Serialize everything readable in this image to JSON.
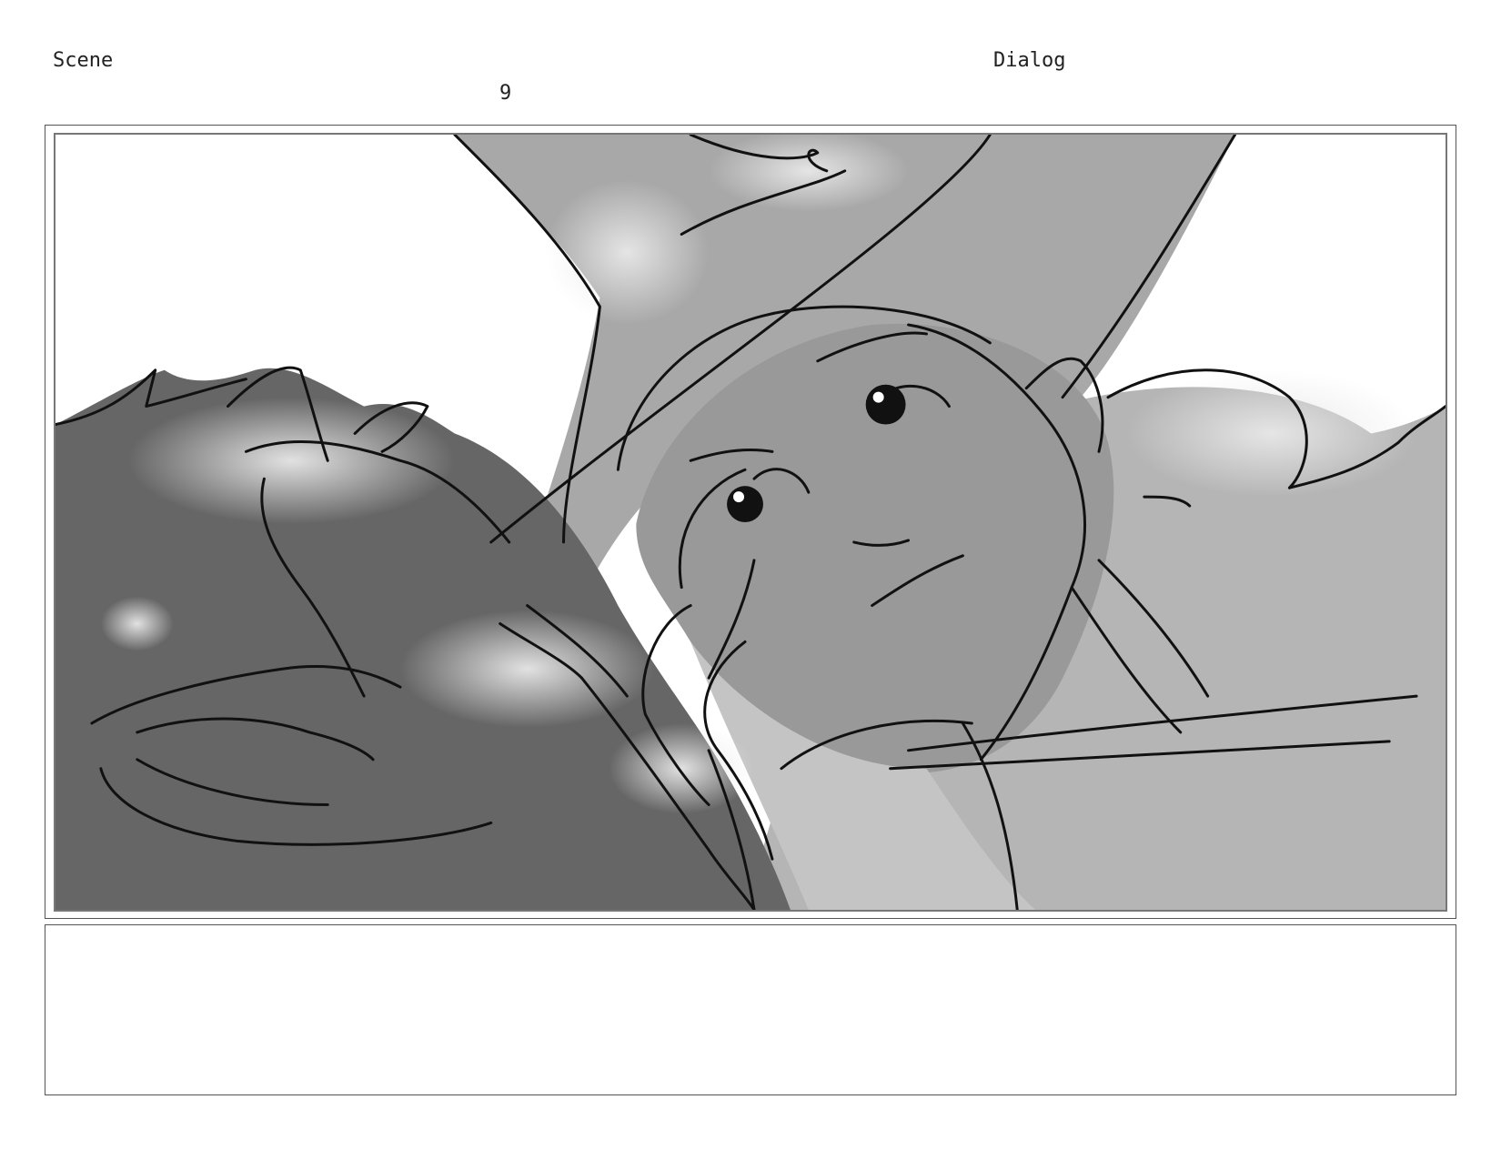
{
  "header": {
    "scene_label": "Scene",
    "scene_number": "9",
    "dialog_label": "Dialog"
  },
  "panel": {
    "content": "storyboard-sketch"
  },
  "dialog": {
    "text": ""
  },
  "colors": {
    "dark_gray": "#6b6b6b",
    "mid_gray": "#9e9e9e",
    "light_gray": "#b9b9b9",
    "ink": "#111111"
  }
}
